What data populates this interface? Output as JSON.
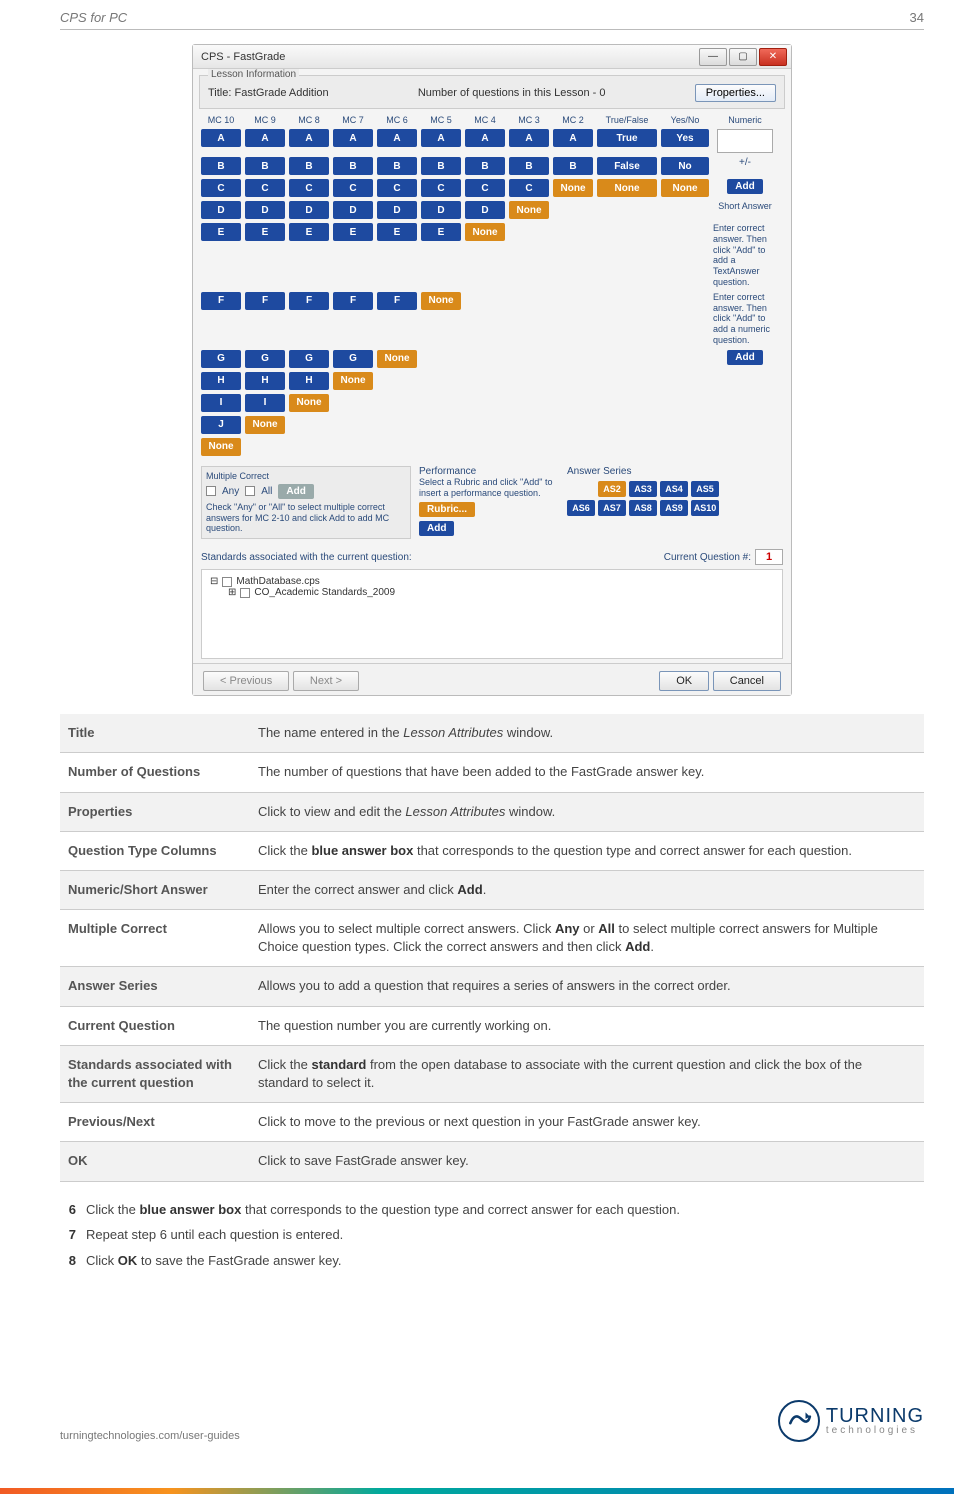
{
  "header": {
    "title": "CPS for PC",
    "page": "34"
  },
  "app": {
    "title": "CPS - FastGrade",
    "lesson_info": {
      "group": "Lesson Information",
      "title_label": "Title:",
      "title_value": "FastGrade Addition",
      "num_q_label": "Number of questions in this Lesson -",
      "num_q_value": "0",
      "properties_btn": "Properties..."
    },
    "mc_cols": [
      "MC 10",
      "MC 9",
      "MC 8",
      "MC 7",
      "MC 6",
      "MC 5",
      "MC 4",
      "MC 3",
      "MC 2"
    ],
    "tf_head": "True/False",
    "yn_head": "Yes/No",
    "num_head": "Numeric",
    "rows": [
      [
        "A",
        "A",
        "A",
        "A",
        "A",
        "A",
        "A",
        "A",
        "A",
        "True",
        "Yes"
      ],
      [
        "B",
        "B",
        "B",
        "B",
        "B",
        "B",
        "B",
        "B",
        "B",
        "False",
        "No"
      ],
      [
        "C",
        "C",
        "C",
        "C",
        "C",
        "C",
        "C",
        "C",
        "None",
        "None",
        "None"
      ],
      [
        "D",
        "D",
        "D",
        "D",
        "D",
        "D",
        "D",
        "None",
        "",
        "",
        ""
      ],
      [
        "E",
        "E",
        "E",
        "E",
        "E",
        "E",
        "None",
        "",
        "",
        "",
        ""
      ],
      [
        "F",
        "F",
        "F",
        "F",
        "F",
        "None",
        "",
        "",
        "",
        "",
        ""
      ],
      [
        "G",
        "G",
        "G",
        "G",
        "None",
        "",
        "",
        "",
        "",
        "",
        ""
      ],
      [
        "H",
        "H",
        "H",
        "None",
        "",
        "",
        "",
        "",
        "",
        "",
        ""
      ],
      [
        "I",
        "I",
        "None",
        "",
        "",
        "",
        "",
        "",
        "",
        "",
        ""
      ],
      [
        "J",
        "None",
        "",
        "",
        "",
        "",
        "",
        "",
        "",
        "",
        ""
      ],
      [
        "None",
        "",
        "",
        "",
        "",
        "",
        "",
        "",
        "",
        "",
        ""
      ]
    ],
    "plusminus": "+/-",
    "add_btn": "Add",
    "short_answer": {
      "head": "Short Answer",
      "help": "Enter correct answer. Then click \"Add\" to add a TextAnswer question.",
      "add": "Add"
    },
    "numeric_help": "Enter correct answer. Then click \"Add\" to add a numeric question.",
    "mult": {
      "head": "Multiple Correct",
      "any": "Any",
      "all": "All",
      "add": "Add",
      "help": "Check \"Any\" or \"All\" to select multiple correct answers for MC 2-10 and click Add to add MC question."
    },
    "perf": {
      "head": "Performance",
      "help": "Select a Rubric and click \"Add\" to insert a performance question.",
      "rubric": "Rubric...",
      "add": "Add"
    },
    "aseries": {
      "head": "Answer Series",
      "cells": [
        "",
        "AS2",
        "AS3",
        "AS4",
        "AS5",
        "AS6",
        "AS7",
        "AS8",
        "AS9",
        "AS10"
      ]
    },
    "std_label": "Standards associated with the current question:",
    "cur_q_label": "Current Question #:",
    "cur_q_value": "1",
    "tree": {
      "root": "MathDatabase.cps",
      "child": "CO_Academic Standards_2009"
    },
    "nav": {
      "prev": "< Previous",
      "next": "Next >",
      "ok": "OK",
      "cancel": "Cancel"
    }
  },
  "defs": [
    {
      "k": "Title",
      "v_pre": "The name entered in the ",
      "v_em": "Lesson Attributes",
      "v_post": " window."
    },
    {
      "k": "Number of Questions",
      "v": "The number of questions that have been added to the FastGrade answer key."
    },
    {
      "k": "Properties",
      "v_pre": "Click to view and edit the ",
      "v_em": "Lesson Attributes",
      "v_post": " window."
    },
    {
      "k": "Question Type Columns",
      "v_pre": "Click the ",
      "v_b1": "blue answer box",
      "v_mid": " that corresponds to the question type and correct answer for each question."
    },
    {
      "k": "Numeric/Short Answer",
      "v_pre": "Enter the correct answer and click ",
      "v_b1": "Add",
      "v_mid": "."
    },
    {
      "k": "Multiple Correct",
      "v_pre": "Allows you to select multiple correct answers. Click ",
      "v_b1": "Any",
      "v_mid": " or ",
      "v_b2": "All",
      "v_mid2": " to select multiple correct answers for Multiple Choice question types. Click the correct answers and then click ",
      "v_b3": "Add",
      "v_post": "."
    },
    {
      "k": "Answer Series",
      "v": "Allows you to add a question that requires a series of answers in the correct order."
    },
    {
      "k": "Current Question",
      "v": "The question number you are currently working on."
    },
    {
      "k": "Standards associated with the current question",
      "v_pre": "Click the ",
      "v_b1": "standard",
      "v_mid": " from the open database to associate with the current question and click the box of the standard to select it."
    },
    {
      "k": "Previous/Next",
      "v": "Click to move to the previous or next question in your FastGrade answer key."
    },
    {
      "k": "OK",
      "v": "Click to save FastGrade answer key."
    }
  ],
  "steps": [
    {
      "n": "6",
      "pre": "Click the ",
      "b": "blue answer box",
      "post": " that corresponds to the question type and correct answer for each question."
    },
    {
      "n": "7",
      "t": "Repeat step 6 until each question is entered."
    },
    {
      "n": "8",
      "pre": "Click ",
      "b": "OK",
      "post": " to save the FastGrade answer key."
    }
  ],
  "footer": {
    "url": "turningtechnologies.com/user-guides",
    "brand1": "TURNING",
    "brand2": "technologies"
  }
}
